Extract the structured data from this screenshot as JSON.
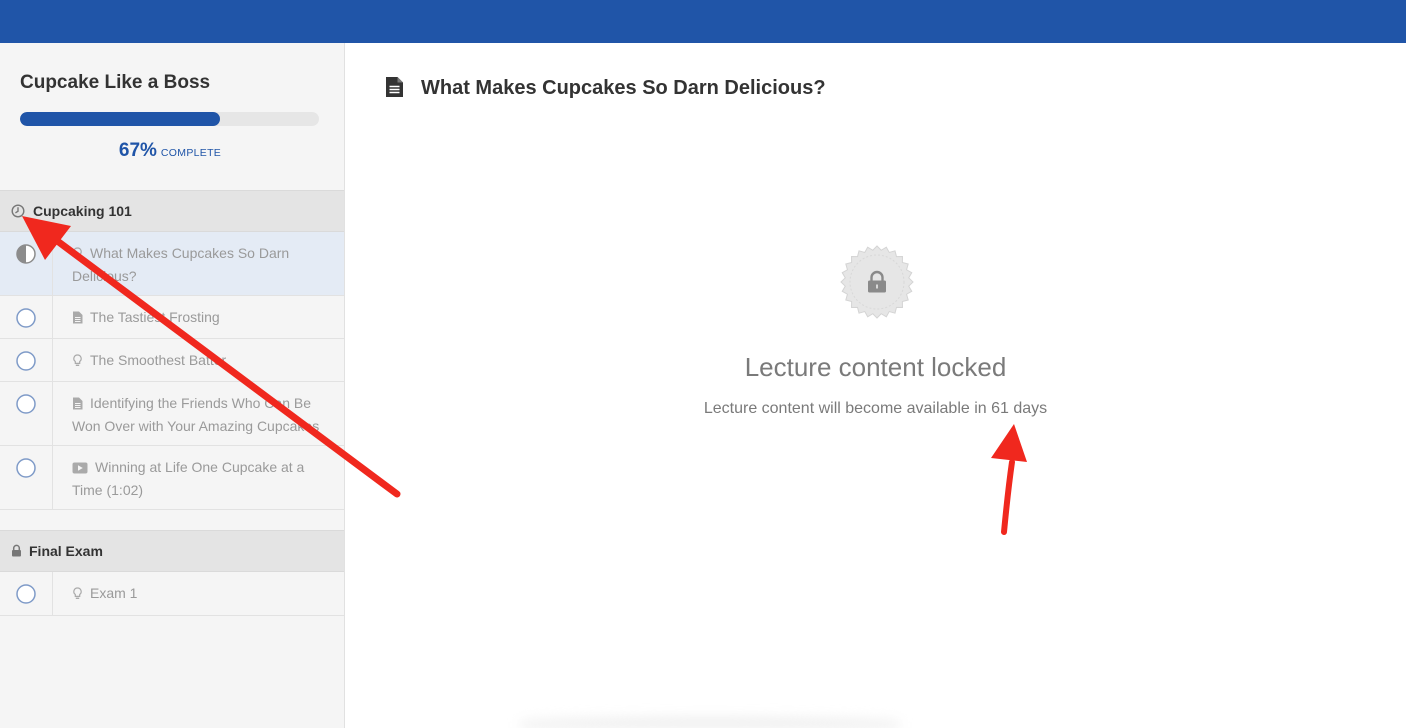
{
  "sidebar": {
    "course_title": "Cupcake Like a Boss",
    "progress": {
      "percent_value": 67,
      "percent_label": "67%",
      "complete_label": "COMPLETE"
    },
    "sections": [
      {
        "title": "Cupcaking 101",
        "icon": "clock-icon",
        "items": [
          {
            "label": "What Makes Cupcakes So Darn Delicious?",
            "type_icon": "lightbulb-icon",
            "status": "in-progress",
            "active": true
          },
          {
            "label": "The Tastiest Frosting",
            "type_icon": "document-icon",
            "status": "incomplete"
          },
          {
            "label": "The Smoothest Batter",
            "type_icon": "lightbulb-icon",
            "status": "incomplete"
          },
          {
            "label": "Identifying the Friends Who Can Be Won Over with Your Amazing Cupcakes",
            "type_icon": "document-icon",
            "status": "incomplete"
          },
          {
            "label": "Winning at Life One Cupcake at a Time (1:02)",
            "type_icon": "video-icon",
            "status": "incomplete"
          }
        ]
      },
      {
        "title": "Final Exam",
        "icon": "lock-icon",
        "items": [
          {
            "label": "Exam 1",
            "type_icon": "lightbulb-icon",
            "status": "incomplete"
          }
        ]
      }
    ]
  },
  "main": {
    "lecture_title": "What Makes Cupcakes So Darn Delicious?",
    "lecture_icon": "document-icon",
    "locked_title": "Lecture content locked",
    "locked_message": "Lecture content will become available in 61 days"
  },
  "colors": {
    "brand": "#2055a8",
    "annotation": "#f0281e"
  }
}
